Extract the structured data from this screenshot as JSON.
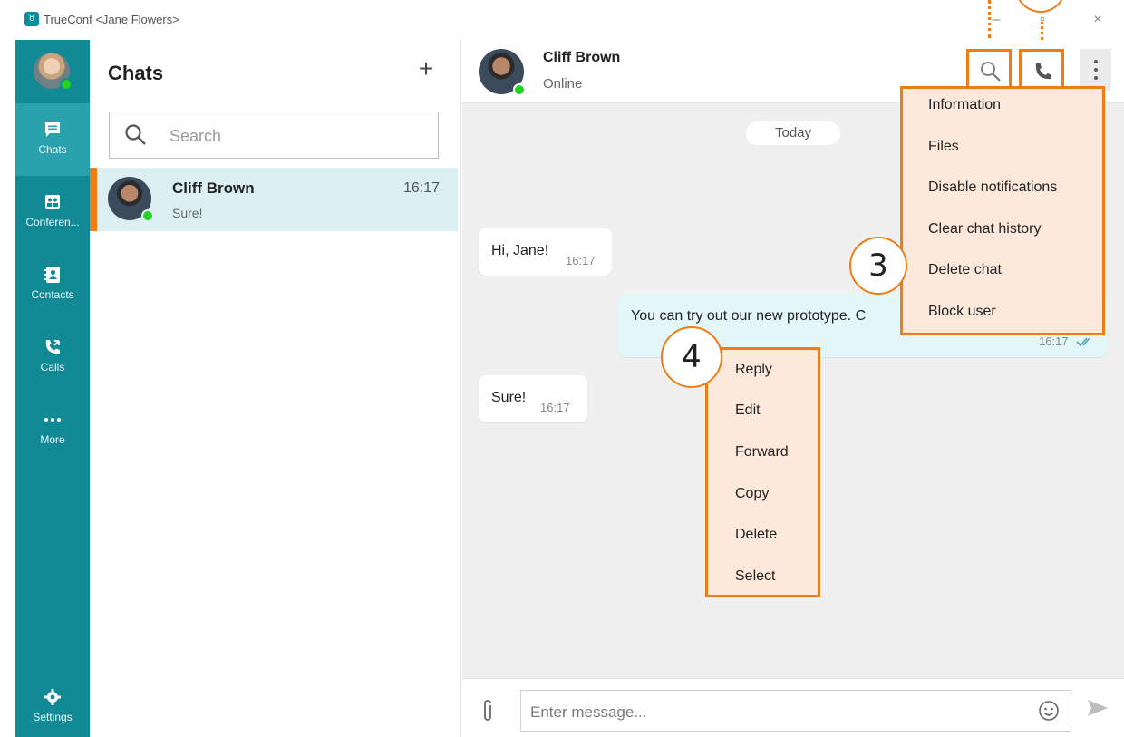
{
  "window": {
    "title": "TrueConf <Jane Flowers>",
    "logo_glyph": "♉",
    "minimize_glyph": "–",
    "maximize_glyph": "▫",
    "close_glyph": "×"
  },
  "rail": {
    "items": [
      {
        "label": "Chats",
        "icon": "chat-icon",
        "active": true
      },
      {
        "label": "Conferen...",
        "icon": "conference-icon",
        "active": false
      },
      {
        "label": "Contacts",
        "icon": "contacts-icon",
        "active": false
      },
      {
        "label": "Calls",
        "icon": "calls-icon",
        "active": false
      },
      {
        "label": "More",
        "icon": "more-icon",
        "active": false
      }
    ],
    "settings_label": "Settings"
  },
  "chats_panel": {
    "title": "Chats",
    "add_glyph": "+",
    "search_placeholder": "Search",
    "list": [
      {
        "name": "Cliff Brown",
        "time": "16:17",
        "preview": "Sure!",
        "selected": true
      }
    ]
  },
  "conversation": {
    "contact_name": "Cliff Brown",
    "contact_status": "Online",
    "date_separator": "Today",
    "messages": [
      {
        "text": "Hi, Jane!",
        "time": "16:17",
        "direction": "incoming"
      },
      {
        "text": "You can try out our new prototype. C",
        "time": "16:17",
        "direction": "outgoing"
      },
      {
        "text": "Sure!",
        "time": "16:17",
        "direction": "incoming"
      }
    ],
    "composer_placeholder": "Enter message..."
  },
  "header_menu": {
    "items": [
      "Information",
      "Files",
      "Disable notifications",
      "Clear chat history",
      "Delete chat",
      "Block user"
    ]
  },
  "message_menu": {
    "items": [
      "Reply",
      "Edit",
      "Forward",
      "Copy",
      "Delete",
      "Select"
    ]
  },
  "callouts": {
    "header_menu_number": "3",
    "message_menu_number": "4"
  },
  "colors": {
    "rail": "#128a96",
    "rail_active": "#2aa2ad",
    "highlight": "#f07c14",
    "menu_bg": "#fde9db",
    "online": "#22d322",
    "selected_row": "#dceff2"
  }
}
